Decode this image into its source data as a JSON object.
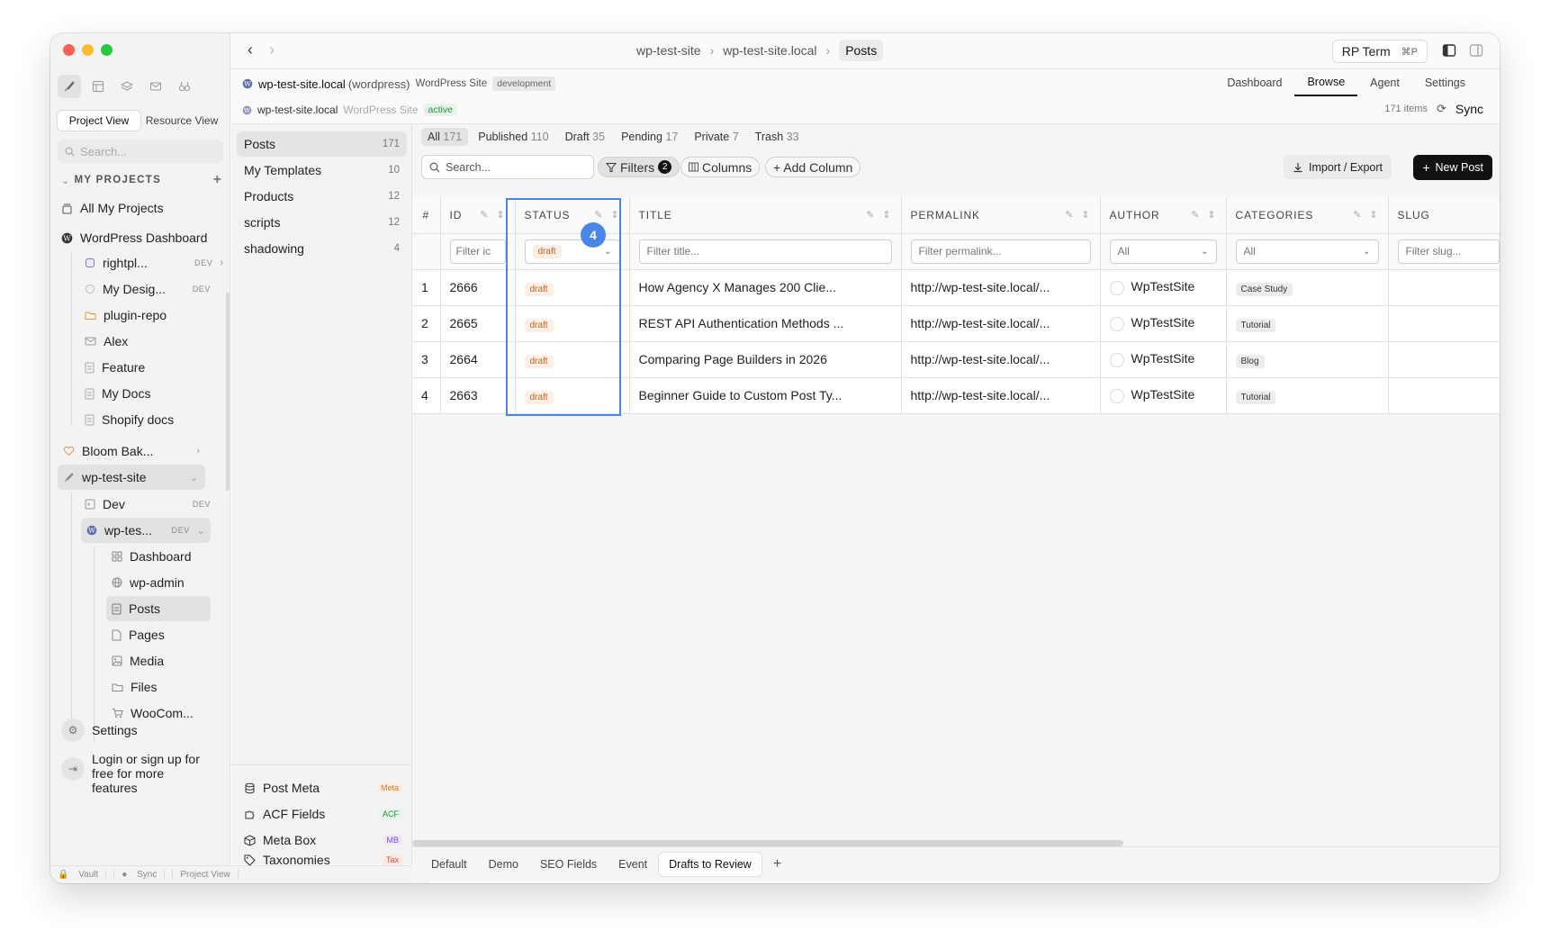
{
  "window": {
    "traffic_colors": [
      "#fe5f57",
      "#febc2e",
      "#28c840"
    ]
  },
  "sidebar": {
    "view_tabs": [
      "Project View",
      "Resource View"
    ],
    "search_placeholder": "Search...",
    "section_title": "MY PROJECTS",
    "items": [
      {
        "label": "All My Projects",
        "icon": "stack-icon"
      },
      {
        "label": "WordPress Dashboard",
        "icon": "wordpress-icon"
      },
      {
        "label": "rightpl...",
        "badge": "DEV",
        "icon": "site-icon"
      },
      {
        "label": "My Desig...",
        "badge": "DEV",
        "icon": "figma-icon"
      },
      {
        "label": "plugin-repo",
        "icon": "folder-icon"
      },
      {
        "label": "Alex",
        "icon": "mail-icon"
      },
      {
        "label": "Feature",
        "icon": "doc-icon"
      },
      {
        "label": "My Docs",
        "icon": "doc-icon"
      },
      {
        "label": "Shopify docs",
        "icon": "doc-icon"
      },
      {
        "label": "Bloom Bak...",
        "icon": "heart-icon"
      },
      {
        "label": "wp-test-site",
        "icon": "feather-icon"
      },
      {
        "label": "Dev",
        "badge": "DEV",
        "icon": "terminal-icon"
      },
      {
        "label": "wp-tes...",
        "badge": "DEV",
        "icon": "wordpress-icon"
      },
      {
        "label": "Dashboard",
        "icon": "grid-icon"
      },
      {
        "label": "wp-admin",
        "icon": "globe-icon"
      },
      {
        "label": "Posts",
        "icon": "doc-icon"
      },
      {
        "label": "Pages",
        "icon": "page-icon"
      },
      {
        "label": "Media",
        "icon": "image-icon"
      },
      {
        "label": "Files",
        "icon": "folder-icon"
      },
      {
        "label": "WooCom...",
        "icon": "cart-icon"
      }
    ],
    "settings_label": "Settings",
    "login_label": "Login or sign up for free for more features"
  },
  "statusbar": [
    "Vault",
    "Sync",
    "Project View"
  ],
  "topbar": {
    "breadcrumbs": [
      "wp-test-site",
      "wp-test-site.local",
      "Posts"
    ],
    "rp_term": "RP Term",
    "rp_term_shortcut": "⌘P"
  },
  "siteinfo": {
    "line1_name": "wp-test-site.local",
    "line1_type": "(wordpress)",
    "line1_kind": "WordPress Site",
    "line1_env": "development",
    "line2_name": "wp-test-site.local",
    "line2_kind": "WordPress Site",
    "line2_status": "active",
    "items_count": "171 items",
    "sync_label": "Sync"
  },
  "view_tabs": [
    "Dashboard",
    "Browse",
    "Agent",
    "Settings"
  ],
  "midnav": {
    "items": [
      {
        "label": "Posts",
        "count": "171"
      },
      {
        "label": "My Templates",
        "count": "10"
      },
      {
        "label": "Products",
        "count": "12"
      },
      {
        "label": "scripts",
        "count": "12"
      },
      {
        "label": "shadowing",
        "count": "4"
      }
    ],
    "meta": [
      {
        "label": "Post Meta",
        "tag": "Meta",
        "tag_color": "#e8762c",
        "tag_bg": "#fdeee2"
      },
      {
        "label": "ACF Fields",
        "tag": "ACF",
        "tag_color": "#2e8b3e",
        "tag_bg": "#e6f4ea"
      },
      {
        "label": "Meta Box",
        "tag": "MB",
        "tag_color": "#7b4fd0",
        "tag_bg": "#efe8fb"
      },
      {
        "label": "Taxonomies",
        "tag": "Tax",
        "tag_color": "#d0522a",
        "tag_bg": "#fde9e2"
      }
    ]
  },
  "status_tabs": [
    {
      "label": "All",
      "count": "171"
    },
    {
      "label": "Published",
      "count": "110"
    },
    {
      "label": "Draft",
      "count": "35"
    },
    {
      "label": "Pending",
      "count": "17"
    },
    {
      "label": "Private",
      "count": "7"
    },
    {
      "label": "Trash",
      "count": "33"
    }
  ],
  "toolbar": {
    "search_placeholder": "Search...",
    "filters_label": "Filters",
    "filters_count": "2",
    "columns_label": "Columns",
    "add_column_label": "+ Add Column",
    "import_label": "Import / Export",
    "new_post_label": "New Post"
  },
  "table": {
    "headers": [
      "#",
      "ID",
      "STATUS",
      "TITLE",
      "PERMALINK",
      "AUTHOR",
      "CATEGORIES",
      "SLUG"
    ],
    "filters": {
      "id": "Filter ic",
      "status": "draft",
      "title": "Filter title...",
      "permalink": "Filter permalink...",
      "author": "All",
      "categories": "All",
      "slug": "Filter slug..."
    },
    "rows": [
      {
        "n": "1",
        "id": "2666",
        "status": "draft",
        "title": "How Agency X Manages 200 Clie...",
        "permalink": "http://wp-test-site.local/...",
        "author": "WpTestSite",
        "category": "Case Study"
      },
      {
        "n": "2",
        "id": "2665",
        "status": "draft",
        "title": "REST API Authentication Methods ...",
        "permalink": "http://wp-test-site.local/...",
        "author": "WpTestSite",
        "category": "Tutorial"
      },
      {
        "n": "3",
        "id": "2664",
        "status": "draft",
        "title": "Comparing Page Builders in 2026",
        "permalink": "http://wp-test-site.local/...",
        "author": "WpTestSite",
        "category": "Blog"
      },
      {
        "n": "4",
        "id": "2663",
        "status": "draft",
        "title": "Beginner Guide to Custom Post Ty...",
        "permalink": "http://wp-test-site.local/...",
        "author": "WpTestSite",
        "category": "Tutorial"
      }
    ]
  },
  "annotation": {
    "number": "4",
    "color": "#4a86e8"
  },
  "bottom_tabs": [
    "Default",
    "Demo",
    "SEO Fields",
    "Event",
    "Drafts to Review"
  ],
  "bottom_add": "+"
}
